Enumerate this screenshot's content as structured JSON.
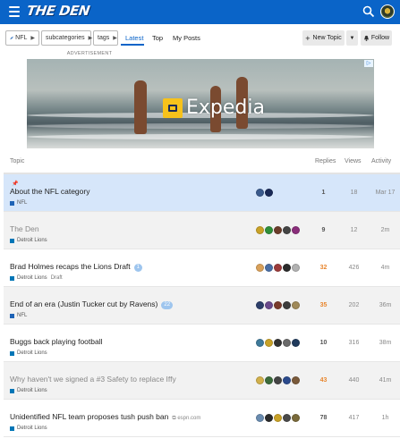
{
  "header": {
    "logo": "THE DEN",
    "icons": [
      "menu-icon",
      "search-icon",
      "avatar"
    ],
    "color": "#0a64c8"
  },
  "nav": {
    "category": "NFL",
    "subcategories": "subcategories",
    "tags": "tags",
    "tabs": [
      "Latest",
      "Top",
      "My Posts"
    ],
    "new_topic": "New Topic",
    "follow": "Follow"
  },
  "ad": {
    "label": "ADVERTISEMENT",
    "brand": "Expedia"
  },
  "table": {
    "headers": {
      "topic": "Topic",
      "replies": "Replies",
      "views": "Views",
      "activity": "Activity"
    },
    "rows": [
      {
        "title": "About the NFL category",
        "category": "NFL",
        "cat_color": "#1e63b6",
        "pinned": true,
        "replies": "1",
        "views": "18",
        "activity": "Mar 17",
        "posters": [
          "#3a5a8c",
          "#1a2a57"
        ],
        "highlight": true
      },
      {
        "title": "The Den",
        "category": "Detroit Lions",
        "cat_color": "#0076b6",
        "visited": true,
        "replies": "9",
        "views": "12",
        "activity": "2m",
        "posters": [
          "#c9a227",
          "#2f8f3a",
          "#6b3c2a",
          "#444",
          "#8a2e7b"
        ]
      },
      {
        "title": "Brad Holmes recaps the Lions Draft",
        "category": "Detroit Lions",
        "cat_color": "#0076b6",
        "tag": "Draft",
        "badge": "1",
        "replies": "32",
        "views": "426",
        "activity": "4m",
        "hot": true,
        "posters": [
          "#d9a15a",
          "#4a6fa5",
          "#9b3b3b",
          "#2b2b2b",
          "#b2b2b2"
        ]
      },
      {
        "title": "End of an era (Justin Tucker cut by Ravens)",
        "category": "NFL",
        "cat_color": "#1e63b6",
        "badge": "22",
        "replies": "35",
        "views": "202",
        "activity": "36m",
        "hot": true,
        "posters": [
          "#2d3f6a",
          "#6a4a8c",
          "#7a3b2b",
          "#3c3c3c",
          "#a08a5a"
        ]
      },
      {
        "title": "Buggs back playing football",
        "category": "Detroit Lions",
        "cat_color": "#0076b6",
        "replies": "10",
        "views": "316",
        "activity": "38m",
        "posters": [
          "#3f7a9a",
          "#c9a227",
          "#333",
          "#6a6a6a",
          "#1f3a5c"
        ]
      },
      {
        "title": "Why haven't we signed a #3 Safety to replace Iffy",
        "category": "Detroit Lions",
        "cat_color": "#0076b6",
        "visited": true,
        "replies": "43",
        "views": "440",
        "activity": "41m",
        "hot": true,
        "posters": [
          "#d1b04b",
          "#3b6b3b",
          "#444",
          "#2b4a8c",
          "#7a5a3a"
        ]
      },
      {
        "title": "Unidentified NFL team proposes tush push ban",
        "category": "Detroit Lions",
        "cat_color": "#0076b6",
        "link": "espn.com",
        "replies": "78",
        "views": "417",
        "activity": "1h",
        "posters": [
          "#6a8cb0",
          "#2b2b2b",
          "#c9a227",
          "#4a4a4a",
          "#7a6a3a"
        ]
      }
    ]
  }
}
